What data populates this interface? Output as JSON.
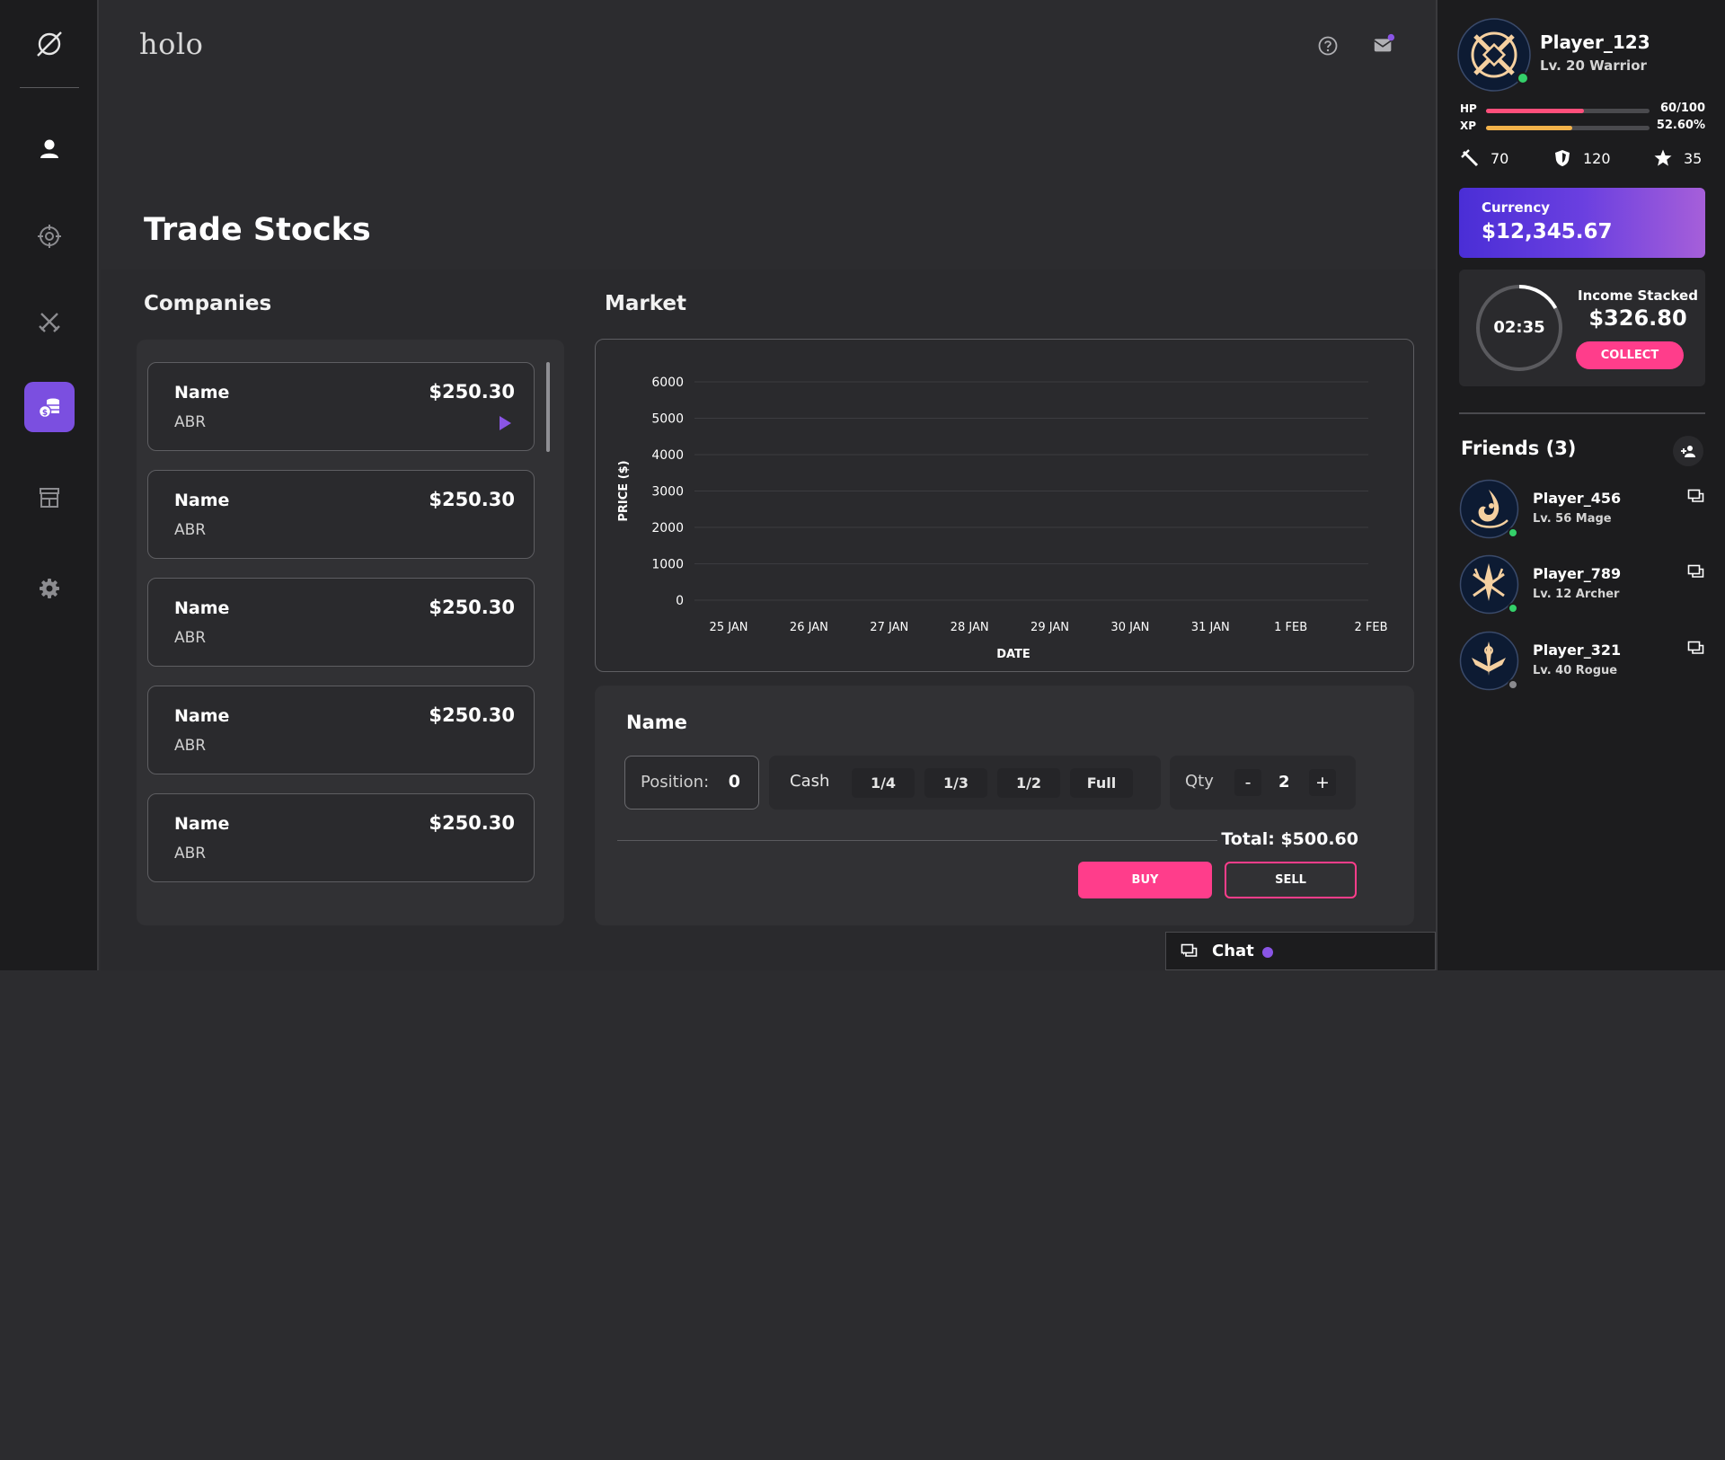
{
  "app": {
    "brand": "holo"
  },
  "page": {
    "title": "Trade Stocks"
  },
  "nav": {
    "items": [
      {
        "name": "profile",
        "icon": "user-icon"
      },
      {
        "name": "quests",
        "icon": "crosshair-icon"
      },
      {
        "name": "battle",
        "icon": "crossed-swords-icon"
      },
      {
        "name": "stocks",
        "icon": "coins-icon",
        "active": true
      },
      {
        "name": "shop",
        "icon": "store-icon"
      },
      {
        "name": "settings",
        "icon": "gear-icon"
      }
    ]
  },
  "companies": {
    "title": "Companies",
    "items": [
      {
        "name": "Name",
        "price": "$250.30",
        "ticker": "ABR",
        "selected": true
      },
      {
        "name": "Name",
        "price": "$250.30",
        "ticker": "ABR"
      },
      {
        "name": "Name",
        "price": "$250.30",
        "ticker": "ABR"
      },
      {
        "name": "Name",
        "price": "$250.30",
        "ticker": "ABR"
      },
      {
        "name": "Name",
        "price": "$250.30",
        "ticker": "ABR"
      }
    ]
  },
  "market": {
    "title": "Market"
  },
  "chart_data": {
    "type": "line",
    "title": "",
    "xlabel": "DATE",
    "ylabel": "PRICE ($)",
    "categories": [
      "25 JAN",
      "26 JAN",
      "27 JAN",
      "28 JAN",
      "29 JAN",
      "30 JAN",
      "31 JAN",
      "1 FEB",
      "2 FEB"
    ],
    "yticks": [
      "6000",
      "5000",
      "4000",
      "3000",
      "2000",
      "1000",
      "0"
    ],
    "ylim": [
      0,
      6000
    ],
    "series": [],
    "grid": true,
    "colors": {
      "grid": "#3c3c40",
      "text": "#ffffff"
    }
  },
  "trade": {
    "name": "Name",
    "position_label": "Position:",
    "position_value": "0",
    "cash_label": "Cash",
    "fractions": [
      "1/4",
      "1/3",
      "1/2",
      "Full"
    ],
    "qty_label": "Qty",
    "qty_minus": "-",
    "qty_plus": "+",
    "qty_value": "2",
    "total": "Total: $500.60",
    "buy_label": "BUY",
    "sell_label": "SELL"
  },
  "chat": {
    "label": "Chat",
    "has_unread": true
  },
  "player": {
    "name": "Player_123",
    "class": "Lv. 20 Warrior",
    "online": true,
    "hp_label": "HP",
    "hp_value": "60/100",
    "hp_fraction": 0.6,
    "xp_label": "XP",
    "xp_value": "52.60%",
    "xp_fraction": 0.526,
    "stats": [
      {
        "icon": "sword-icon",
        "value": "70"
      },
      {
        "icon": "shield-icon",
        "value": "120"
      },
      {
        "icon": "star-icon",
        "value": "35"
      }
    ]
  },
  "currency": {
    "label": "Currency",
    "value": "$12,345.67"
  },
  "income": {
    "timer": "02:35",
    "label": "Income Stacked",
    "value": "$326.80",
    "collect_label": "COLLECT",
    "progress": 0.17
  },
  "friends": {
    "title": "Friends (3)",
    "items": [
      {
        "name": "Player_456",
        "class": "Lv. 56 Mage",
        "online": true
      },
      {
        "name": "Player_789",
        "class": "Lv. 12 Archer",
        "online": true
      },
      {
        "name": "Player_321",
        "class": "Lv. 40 Rogue",
        "online": false
      }
    ]
  },
  "colors": {
    "accent_purple": "#7b4fe0",
    "accent_pink": "#ff3d8b",
    "hp": "#ff4f7b",
    "xp": "#f3b24a",
    "online": "#34d06a",
    "offline": "#8a8a8e"
  }
}
